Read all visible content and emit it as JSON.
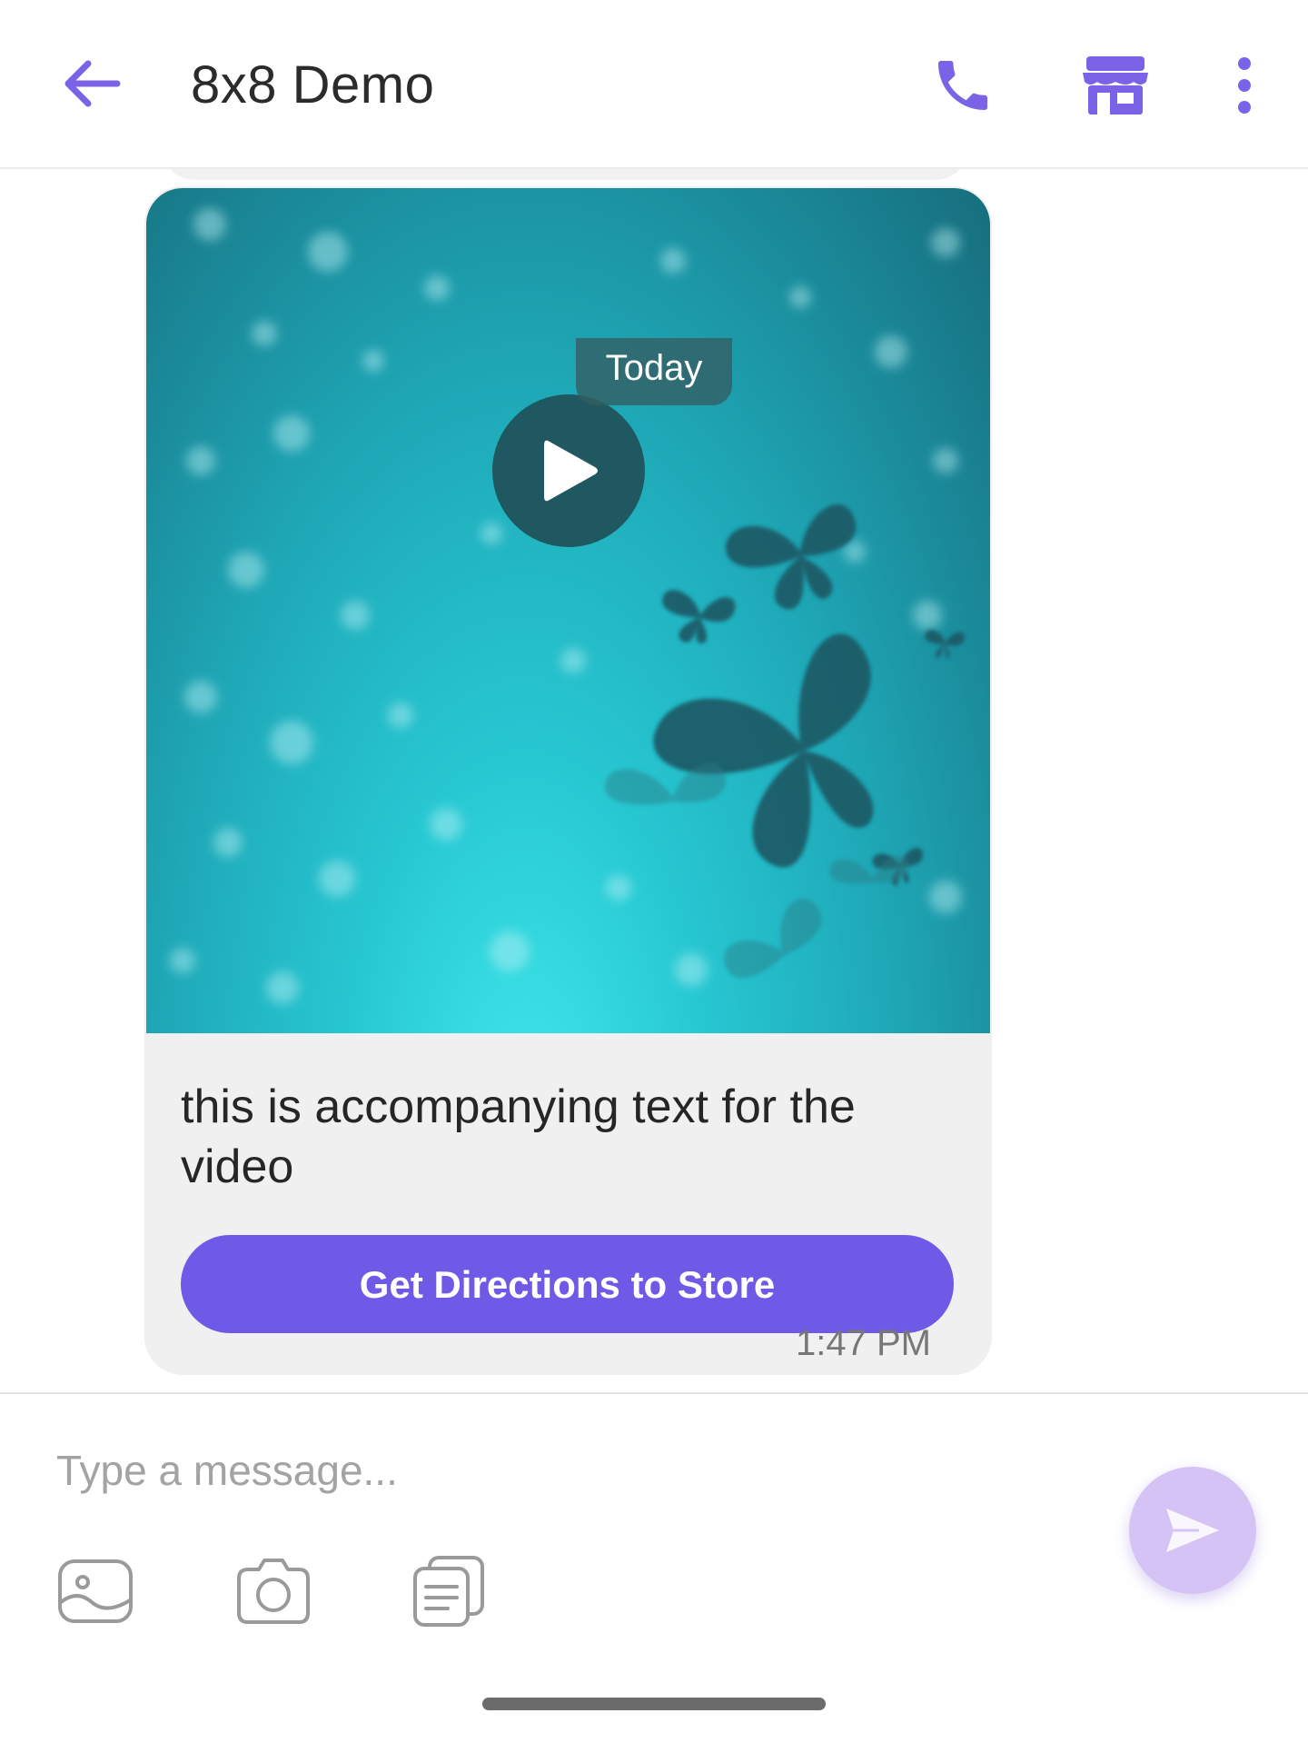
{
  "header": {
    "title": "8x8 Demo",
    "icons": [
      "back-arrow-icon",
      "phone-icon",
      "store-icon",
      "more-vertical-icon"
    ]
  },
  "conversation": {
    "date_label": "Today",
    "message": {
      "media_type": "video",
      "caption": "this is accompanying text for the video",
      "button_label": "Get Directions to Store",
      "time": "1:47 PM"
    }
  },
  "composer": {
    "placeholder": "Type a message..."
  },
  "colors": {
    "accent": "#7b63e8",
    "button": "#6e5ae6",
    "send_button": "#d6c3f6",
    "bubble": "#f0f0f1"
  }
}
